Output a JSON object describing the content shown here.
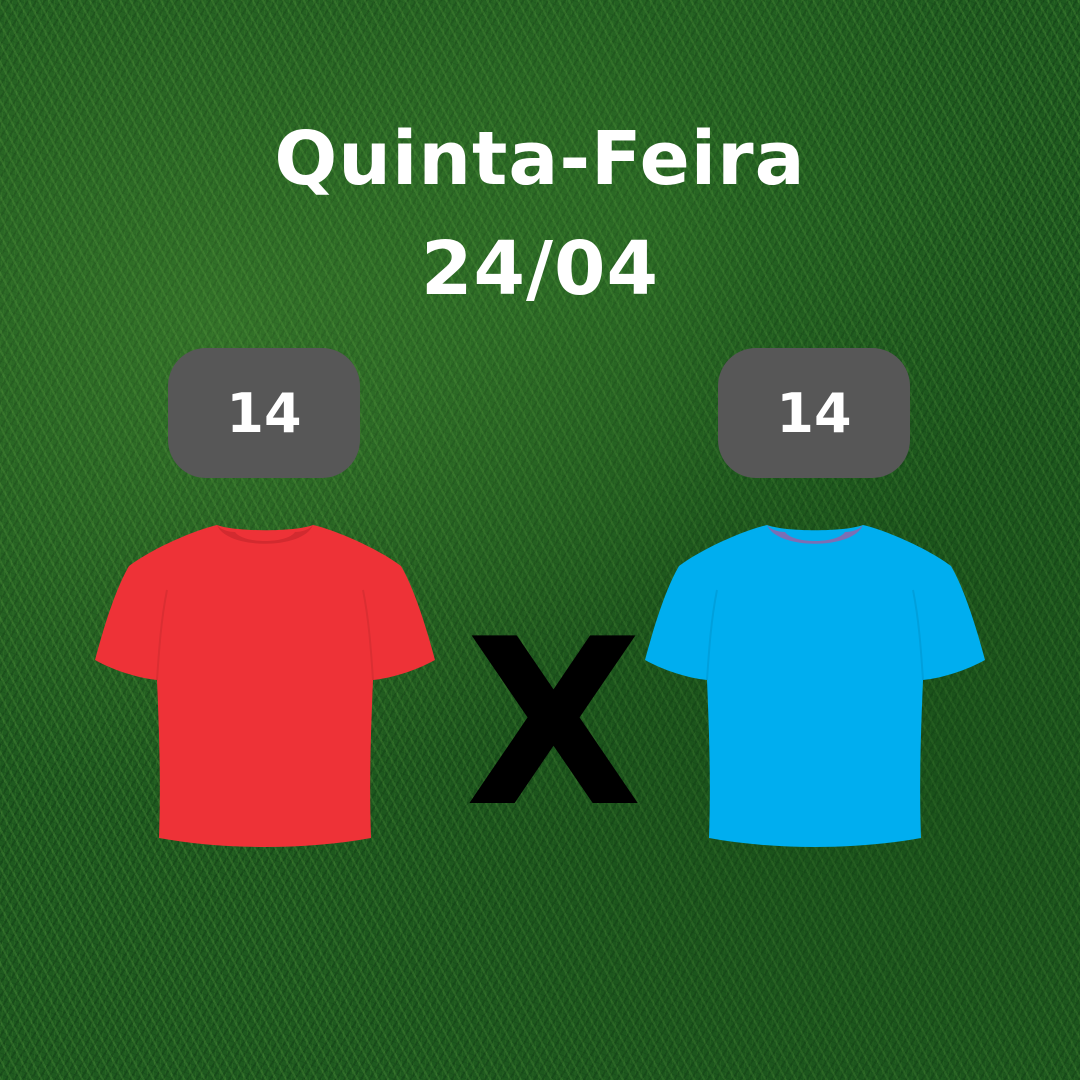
{
  "header": {
    "day": "Quinta-Feira",
    "date": "24/04"
  },
  "teams": [
    {
      "count": "14",
      "shirt_color": "#ee3237",
      "collar_color": "#d32a2f",
      "icon": "tshirt-icon"
    },
    {
      "count": "14",
      "shirt_color": "#00aeef",
      "collar_color": "#7a6fb5",
      "icon": "tshirt-icon"
    }
  ],
  "versus": "X",
  "colors": {
    "badge_bg": "#575757",
    "text": "#ffffff",
    "background": "grass-field"
  }
}
